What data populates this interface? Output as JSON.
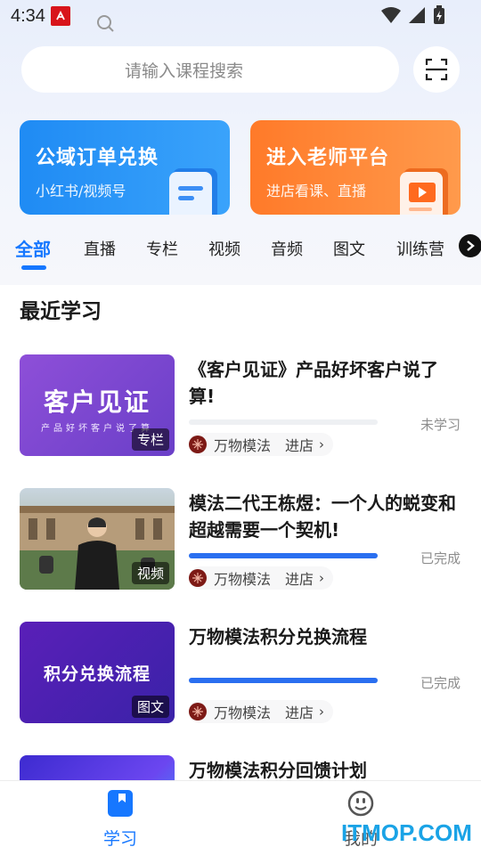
{
  "status_bar": {
    "time": "4:34"
  },
  "search": {
    "placeholder": "请输入课程搜索"
  },
  "cards": [
    {
      "title": "公域订单兑换",
      "subtitle": "小红书/视频号"
    },
    {
      "title": "进入老师平台",
      "subtitle": "进店看课、直播"
    }
  ],
  "tabs": [
    {
      "label": "全部",
      "active": true
    },
    {
      "label": "直播"
    },
    {
      "label": "专栏"
    },
    {
      "label": "视频"
    },
    {
      "label": "音频"
    },
    {
      "label": "图文"
    },
    {
      "label": "训练营"
    }
  ],
  "section": {
    "title": "最近学习"
  },
  "courses": [
    {
      "title": "《客户见证》产品好坏客户说了算!",
      "thumb_text": "客户见证",
      "thumb_subtext": "产品好坏客户说了算",
      "tag": "专栏",
      "progress": 0,
      "status": "未学习",
      "store": "万物模法",
      "enter": "进店"
    },
    {
      "title": "模法二代王栋煜：一个人的蜕变和超越需要一个契机!",
      "tag": "视频",
      "progress": 1.0,
      "status": "已完成",
      "store": "万物模法",
      "enter": "进店"
    },
    {
      "title": "万物模法积分兑换流程",
      "thumb_text": "积分兑换流程",
      "tag": "图文",
      "progress": 1.0,
      "status": "已完成",
      "store": "万物模法",
      "enter": "进店"
    },
    {
      "title": "万物模法积分回馈计划"
    }
  ],
  "bottom_nav": [
    {
      "label": "学习",
      "active": true
    },
    {
      "label": "我的"
    }
  ],
  "watermark": "ITMOP.COM",
  "colors": {
    "accent": "#1677ff",
    "progress": "#2a6ff0",
    "orange": "#ff7a29"
  }
}
